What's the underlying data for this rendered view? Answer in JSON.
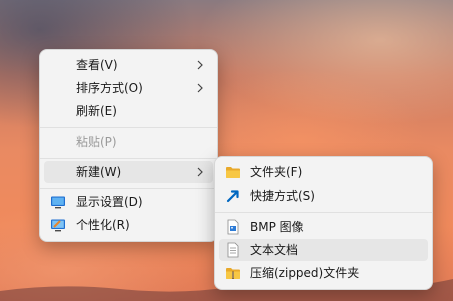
{
  "context_menu": {
    "items": [
      {
        "label": "查看(V)",
        "has_submenu": true
      },
      {
        "label": "排序方式(O)",
        "has_submenu": true
      },
      {
        "label": "刷新(E)"
      },
      {
        "label": "粘贴(P)",
        "disabled": true
      },
      {
        "label": "新建(W)",
        "has_submenu": true,
        "highlighted": true
      },
      {
        "label": "显示设置(D)",
        "icon": "display-icon"
      },
      {
        "label": "个性化(R)",
        "icon": "personalize-icon"
      }
    ]
  },
  "new_submenu": {
    "items": [
      {
        "label": "文件夹(F)",
        "icon": "folder-icon"
      },
      {
        "label": "快捷方式(S)",
        "icon": "shortcut-icon"
      },
      {
        "label": "BMP 图像",
        "icon": "bmp-image-icon"
      },
      {
        "label": "文本文档",
        "icon": "text-document-icon",
        "highlighted": true
      },
      {
        "label": "压缩(zipped)文件夹",
        "icon": "zip-folder-icon"
      }
    ]
  },
  "colors": {
    "menu_background": "#f3f3f3",
    "hover_background": "#e6e6e6",
    "disabled_text": "#9a9a9a",
    "folder_yellow": "#f7c744",
    "accent_blue": "#0067c0"
  }
}
